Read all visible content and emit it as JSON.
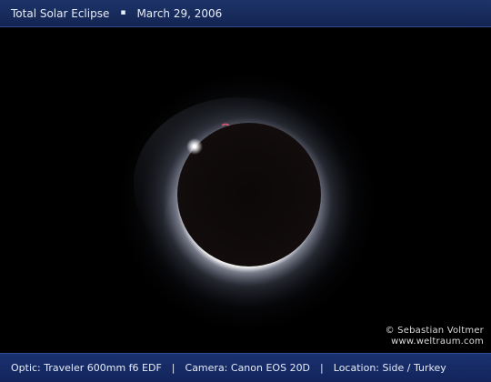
{
  "header": {
    "title": "Total Solar Eclipse",
    "separator": "▪",
    "date": "March 29, 2006"
  },
  "credit": {
    "copyright": "© Sebastian Voltmer",
    "website": "www.weltraum.com"
  },
  "footer": {
    "optic": "Optic: Traveler 600mm f6 EDF",
    "camera": "Camera: Canon EOS 20D",
    "location": "Location: Side / Turkey",
    "divider": "|"
  },
  "colors": {
    "header_bg": "#17295c",
    "footer_bg": "#152a63",
    "sky": "#000000",
    "moon": "#0a0707",
    "corona": "#e8ecff",
    "prominence": "#ff3a6a"
  }
}
